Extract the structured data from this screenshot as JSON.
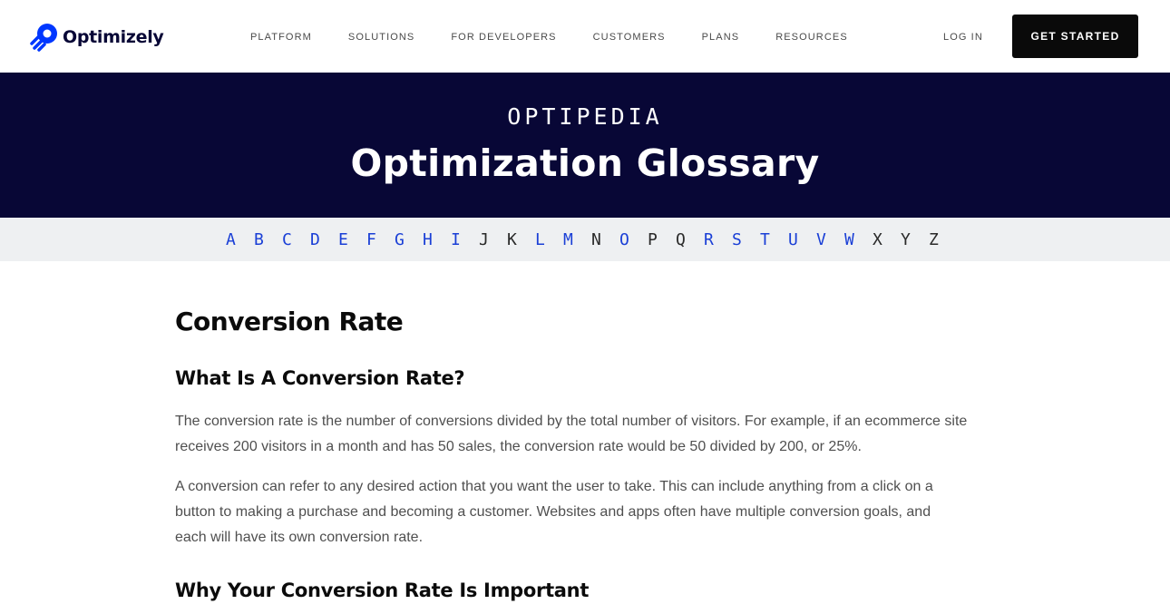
{
  "brand": {
    "name": "Optimizely",
    "accent": "#0037ff",
    "navy": "#080736"
  },
  "nav": {
    "items": [
      "PLATFORM",
      "SOLUTIONS",
      "FOR DEVELOPERS",
      "CUSTOMERS",
      "PLANS",
      "RESOURCES"
    ],
    "login": "LOG IN",
    "cta": "GET STARTED"
  },
  "hero": {
    "eyebrow": "OPTIPEDIA",
    "title": "Optimization Glossary"
  },
  "alphabet": [
    {
      "letter": "A",
      "link": true
    },
    {
      "letter": "B",
      "link": true
    },
    {
      "letter": "C",
      "link": true
    },
    {
      "letter": "D",
      "link": true
    },
    {
      "letter": "E",
      "link": true
    },
    {
      "letter": "F",
      "link": true
    },
    {
      "letter": "G",
      "link": true
    },
    {
      "letter": "H",
      "link": true
    },
    {
      "letter": "I",
      "link": true
    },
    {
      "letter": "J",
      "link": false
    },
    {
      "letter": "K",
      "link": false
    },
    {
      "letter": "L",
      "link": true
    },
    {
      "letter": "M",
      "link": true
    },
    {
      "letter": "N",
      "link": false
    },
    {
      "letter": "O",
      "link": true
    },
    {
      "letter": "P",
      "link": false
    },
    {
      "letter": "Q",
      "link": false
    },
    {
      "letter": "R",
      "link": true
    },
    {
      "letter": "S",
      "link": true
    },
    {
      "letter": "T",
      "link": true
    },
    {
      "letter": "U",
      "link": true
    },
    {
      "letter": "V",
      "link": true
    },
    {
      "letter": "W",
      "link": true
    },
    {
      "letter": "X",
      "link": false
    },
    {
      "letter": "Y",
      "link": false
    },
    {
      "letter": "Z",
      "link": false
    }
  ],
  "article": {
    "title": "Conversion Rate",
    "section1_heading": "What Is A Conversion Rate?",
    "paragraph1_line1": "The conversion rate is the number of conversions divided by the total number of visitors. For example, if an ecommerce site",
    "paragraph1_line2": "receives 200 visitors in a month and has 50 sales, the conversion rate would be 50 divided by 200, or 25%.",
    "paragraph2_line1": "A conversion can refer to any desired action that you want the user to take. This can include anything from a click on a",
    "paragraph2_line2": "button to making a purchase and becoming a customer. Websites and apps often have multiple conversion goals, and",
    "paragraph2_line3": "each will have its own conversion rate.",
    "section2_heading": "Why Your Conversion Rate Is Important"
  }
}
